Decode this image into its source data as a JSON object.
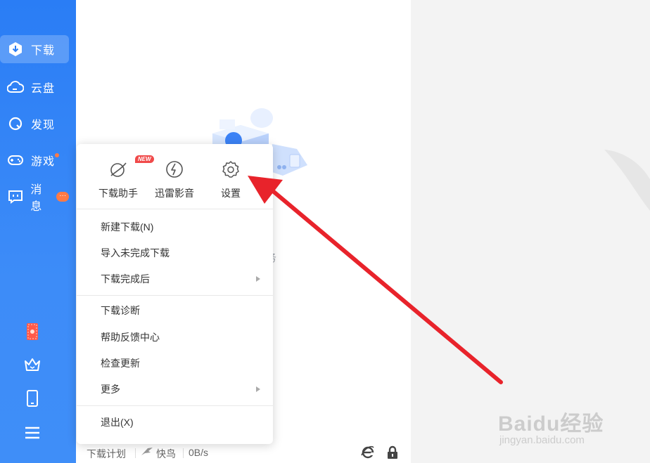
{
  "sidebar": {
    "items": [
      {
        "label": "下载",
        "icon": "download-icon"
      },
      {
        "label": "云盘",
        "icon": "cloud-icon"
      },
      {
        "label": "发现",
        "icon": "discover-icon"
      },
      {
        "label": "游戏",
        "icon": "gamepad-icon"
      },
      {
        "label": "消息",
        "icon": "message-icon",
        "badge": "···"
      }
    ],
    "bottom_icons": [
      "card-game-icon",
      "crown-icon",
      "phone-icon",
      "hamburger-menu-icon"
    ]
  },
  "main": {
    "empty_text": "务"
  },
  "menu": {
    "tools": [
      {
        "label": "下载助手",
        "icon": "download-assistant-icon",
        "tag": "NEW"
      },
      {
        "label": "迅雷影音",
        "icon": "player-icon"
      },
      {
        "label": "设置",
        "icon": "gear-icon"
      }
    ],
    "group1": [
      "新建下载(N)",
      "导入未完成下载",
      "下载完成后"
    ],
    "group2": [
      "下载诊断",
      "帮助反馈中心",
      "检查更新",
      "更多"
    ],
    "group3": [
      "退出(X)"
    ]
  },
  "status_bar": {
    "plan": "下载计划",
    "bird": "快鸟",
    "speed": "0B/s"
  },
  "watermark": {
    "line1": "Baidu经验",
    "line2": "jingyan.baidu.com"
  },
  "colors": {
    "sidebar": "#2a7df5",
    "accent_red": "#e8232b",
    "badge": "#ff7a45"
  }
}
